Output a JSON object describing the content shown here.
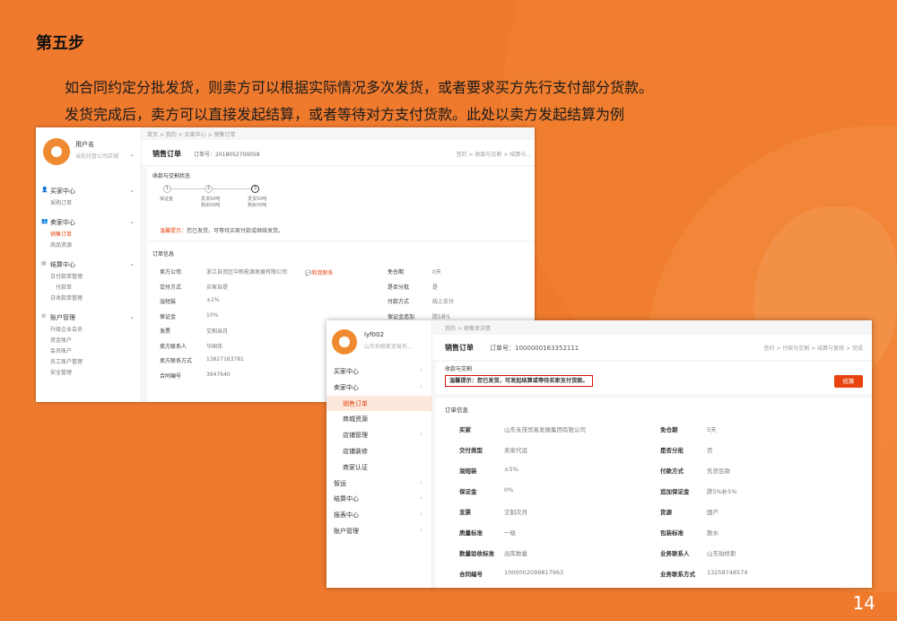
{
  "slide": {
    "title": "第五步",
    "desc1": "如合同约定分批发货，则卖方可以根据实际情况多次发货，或者要求买方先行支付部分货款。",
    "desc2": "发货完成后，卖方可以直接发起结算，或者等待对方支付货款。此处以卖方发起结算为例",
    "page": "14"
  },
  "colors": {
    "brand": "#e8430f",
    "background": "#ef7a2e"
  },
  "s1": {
    "user": {
      "name": "用户名",
      "company": "当前托管公司店铺"
    },
    "breadcrumb": "首页 > 我的 > 买家中心 > 销售订单",
    "header": {
      "title": "销售订单",
      "order_no": "订单号：2018052700058",
      "steps_right": "签约 > 收款与交割 > 结算与..."
    },
    "nav": [
      {
        "group": "买家中心",
        "items": [
          "采购订单"
        ]
      },
      {
        "group": "卖家中心",
        "items": [
          "销售订单",
          "商品资源"
        ]
      },
      {
        "group": "结算中心",
        "items": [
          "日付款单管理",
          "付款单",
          "日收款单管理"
        ]
      },
      {
        "group": "账户管理",
        "items": [
          "升级企业会员",
          "资金账户",
          "会员账户",
          "员工账户管理",
          "安全管理"
        ]
      }
    ],
    "status": {
      "section": "收款与交割状态",
      "steps": [
        {
          "n": "1",
          "label": "保证金"
        },
        {
          "n": "2",
          "label": "发货50吨\n剩余50吨"
        },
        {
          "n": "3",
          "label": "发货50吨\n剩余50吨"
        }
      ],
      "tip_label": "温馨提示：",
      "tip": "您已发货，可等待买家付款或继续发货。"
    },
    "order": {
      "section": "订单信息",
      "left": [
        [
          "卖方公司",
          "浙江自贸区中郎能源发展有限公司"
        ],
        [
          "交付方式",
          "买家自提"
        ],
        [
          "溢短装",
          "±1%"
        ],
        [
          "保证金",
          "10%"
        ],
        [
          "发票",
          "交割当月"
        ],
        [
          "卖方联系人",
          "华国伟"
        ],
        [
          "卖方联系方式",
          "13827163781"
        ],
        [
          "合同编号",
          "3647640"
        ]
      ],
      "contact": "和我联系",
      "right": [
        [
          "免仓期",
          "0天"
        ],
        [
          "是否分批",
          "是"
        ],
        [
          "付款方式",
          "线上支付"
        ],
        [
          "保证金追加",
          "跌5补5"
        ]
      ]
    }
  },
  "s2": {
    "user": {
      "name": "lyf002",
      "company": "山东珀修斯贸易有..."
    },
    "breadcrumb": "我的 > 销售单详情",
    "header": {
      "title": "销售订单",
      "order_no": "订单号：1000000163352111",
      "steps": "签约 > 付款与交割 > 结算与复核 > 完成"
    },
    "nav": [
      {
        "label": "买家中心",
        "level": "group"
      },
      {
        "label": "卖家中心",
        "level": "group"
      },
      {
        "label": "销售订单",
        "level": "item"
      },
      {
        "label": "商城资源",
        "level": "item"
      },
      {
        "label": "店铺管理",
        "level": "item"
      },
      {
        "label": "店铺装修",
        "level": "item"
      },
      {
        "label": "商家认证",
        "level": "item"
      },
      {
        "label": "智运",
        "level": "group"
      },
      {
        "label": "结算中心",
        "level": "group"
      },
      {
        "label": "报表中心",
        "level": "group"
      },
      {
        "label": "账户管理",
        "level": "group"
      }
    ],
    "delivery": {
      "section": "收款与交割",
      "tip": "温馨提示：您已发货，可发起结算或等待买家支付货款。",
      "button": "结算"
    },
    "order": {
      "section": "订单信息",
      "left": [
        [
          "买家",
          "山东永茂贸易发展集团有限公司"
        ],
        [
          "交付类型",
          "卖家代运"
        ],
        [
          "溢短装",
          "±5%"
        ],
        [
          "保证金",
          "0%"
        ],
        [
          "发票",
          "交割次月"
        ],
        [
          "质量标准",
          "一级"
        ],
        [
          "数量验收标准",
          "出库数量"
        ],
        [
          "合同编号",
          "1000002099817963"
        ]
      ],
      "right": [
        [
          "免仓期",
          "5天"
        ],
        [
          "是否分批",
          "否"
        ],
        [
          "付款方式",
          "先货后款"
        ],
        [
          "追加保证金",
          "跌5%补5%"
        ],
        [
          "货源",
          "国产"
        ],
        [
          "包装标准",
          "散水"
        ],
        [
          "业务联系人",
          "山东珀修斯"
        ],
        [
          "业务联系方式",
          "13258748574"
        ]
      ]
    }
  }
}
